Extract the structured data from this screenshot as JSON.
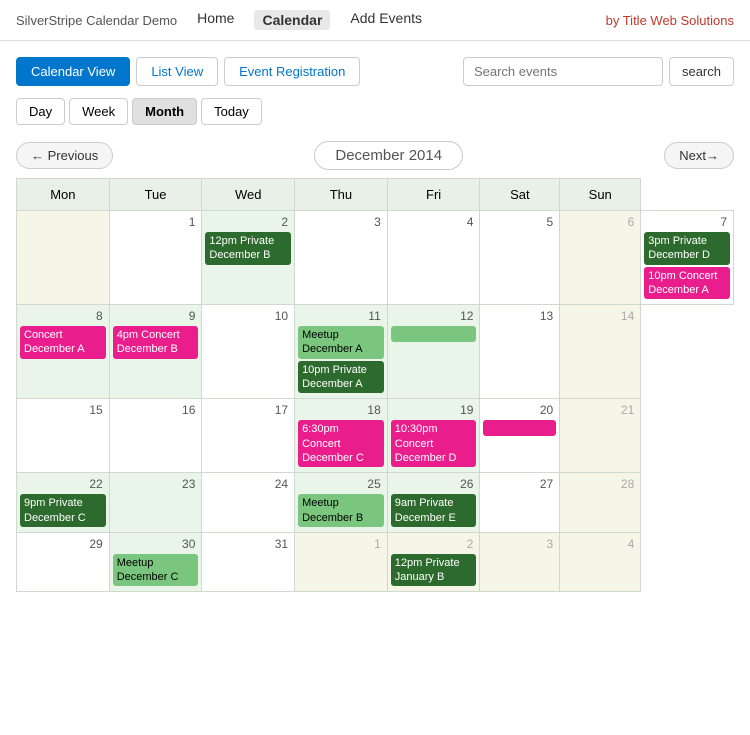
{
  "brand": "SilverStripe Calendar Demo",
  "nav": {
    "links": [
      {
        "label": "Home",
        "active": false
      },
      {
        "label": "Calendar",
        "active": true
      },
      {
        "label": "Add Events",
        "active": false
      }
    ],
    "by_title": "by Title Web Solutions"
  },
  "views": {
    "calendar_view": "Calendar View",
    "list_view": "List View",
    "event_registration": "Event Registration"
  },
  "search": {
    "placeholder": "Search events",
    "button": "search"
  },
  "period_buttons": [
    "Day",
    "Week",
    "Month",
    "Today"
  ],
  "navigation": {
    "previous": "← Previous",
    "current": "December 2014",
    "next": "Next→"
  },
  "days_of_week": [
    "Mon",
    "Tue",
    "Wed",
    "Thu",
    "Fri",
    "Sat",
    "Sun"
  ],
  "weeks": [
    {
      "days": [
        {
          "num": "",
          "type": "other-month",
          "events": []
        },
        {
          "num": "1",
          "type": "cur-month",
          "events": []
        },
        {
          "num": "2",
          "type": "green-bg",
          "events": [
            {
              "color": "dark-green",
              "text": "12pm Private December B"
            }
          ]
        },
        {
          "num": "3",
          "type": "cur-month",
          "events": []
        },
        {
          "num": "4",
          "type": "cur-month",
          "events": []
        },
        {
          "num": "5",
          "type": "cur-month",
          "events": []
        },
        {
          "num": "6",
          "type": "other-month",
          "events": []
        },
        {
          "num": "7",
          "type": "cur-month",
          "events": [
            {
              "color": "dark-green",
              "text": "3pm Private December D"
            },
            {
              "color": "pink",
              "text": "10pm Concert December A"
            }
          ]
        }
      ]
    },
    {
      "days": [
        {
          "num": "8",
          "type": "green-bg",
          "events": [
            {
              "color": "pink",
              "text": "Concert December A"
            }
          ]
        },
        {
          "num": "9",
          "type": "green-bg",
          "events": [
            {
              "color": "pink",
              "text": "4pm Concert December B"
            }
          ]
        },
        {
          "num": "10",
          "type": "cur-month",
          "events": []
        },
        {
          "num": "11",
          "type": "green-bg",
          "events": [
            {
              "color": "light-green",
              "text": "Meetup December A"
            },
            {
              "color": "dark-green",
              "text": "10pm Private December A"
            }
          ]
        },
        {
          "num": "12",
          "type": "green-bg",
          "events": []
        },
        {
          "num": "13",
          "type": "cur-month",
          "events": []
        },
        {
          "num": "14",
          "type": "other-month",
          "events": []
        }
      ]
    },
    {
      "days": [
        {
          "num": "15",
          "type": "cur-month",
          "events": []
        },
        {
          "num": "16",
          "type": "cur-month",
          "events": []
        },
        {
          "num": "17",
          "type": "cur-month",
          "events": []
        },
        {
          "num": "18",
          "type": "green-bg",
          "events": [
            {
              "color": "pink",
              "text": "6:30pm Concert December C"
            }
          ]
        },
        {
          "num": "19",
          "type": "green-bg",
          "events": [
            {
              "color": "pink",
              "text": "10:30pm Concert December D"
            }
          ]
        },
        {
          "num": "20",
          "type": "cur-month",
          "events": []
        },
        {
          "num": "21",
          "type": "other-month",
          "events": []
        }
      ]
    },
    {
      "days": [
        {
          "num": "22",
          "type": "green-bg",
          "events": [
            {
              "color": "dark-green",
              "text": "9pm Private December C"
            }
          ]
        },
        {
          "num": "23",
          "type": "green-bg",
          "events": []
        },
        {
          "num": "24",
          "type": "cur-month",
          "events": []
        },
        {
          "num": "25",
          "type": "green-bg",
          "events": [
            {
              "color": "light-green",
              "text": "Meetup December B"
            }
          ]
        },
        {
          "num": "26",
          "type": "green-bg",
          "events": [
            {
              "color": "dark-green",
              "text": "9am Private December E"
            }
          ]
        },
        {
          "num": "27",
          "type": "cur-month",
          "events": []
        },
        {
          "num": "28",
          "type": "other-month",
          "events": []
        }
      ]
    },
    {
      "days": [
        {
          "num": "29",
          "type": "cur-month",
          "events": []
        },
        {
          "num": "30",
          "type": "green-bg",
          "events": [
            {
              "color": "light-green",
              "text": "Meetup December C"
            }
          ]
        },
        {
          "num": "31",
          "type": "cur-month",
          "events": []
        },
        {
          "num": "1",
          "type": "other-month",
          "events": []
        },
        {
          "num": "2",
          "type": "other-month",
          "events": [
            {
              "color": "dark-green",
              "text": "12pm Private January B"
            }
          ]
        },
        {
          "num": "3",
          "type": "other-month",
          "events": []
        },
        {
          "num": "4",
          "type": "other-month",
          "events": []
        }
      ]
    }
  ]
}
